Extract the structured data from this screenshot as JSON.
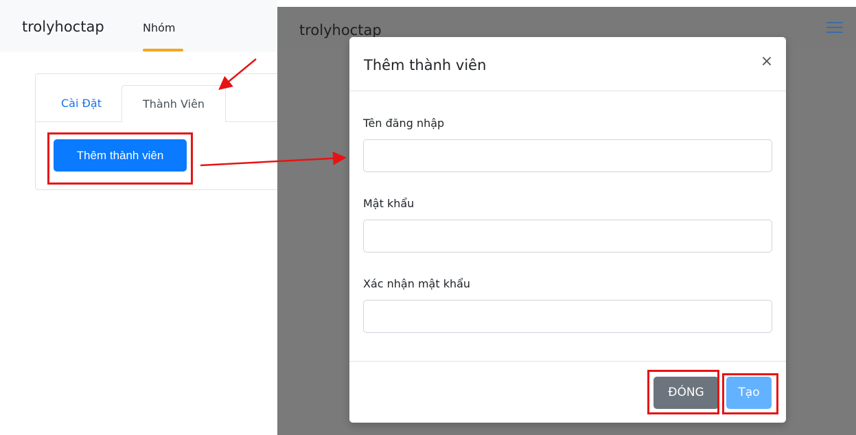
{
  "left_panel": {
    "brand": "trolyhoctap",
    "nav_link": "Nhóm",
    "tabs": [
      {
        "label": "Cài Đặt"
      },
      {
        "label": "Thành Viên"
      }
    ],
    "add_member_button": "Thêm thành viên"
  },
  "right_panel": {
    "brand": "trolyhoctap"
  },
  "modal": {
    "title": "Thêm thành viên",
    "close_symbol": "×",
    "fields": [
      {
        "label": "Tên đăng nhập",
        "value": ""
      },
      {
        "label": "Mật khẩu",
        "value": ""
      },
      {
        "label": "Xác nhận mật khẩu",
        "value": ""
      }
    ],
    "close_button": "ĐÓNG",
    "create_button": "Tạo"
  },
  "colors": {
    "primary": "#0a7aff",
    "secondary": "#6c757d",
    "create_light": "#62b2ff",
    "nav_accent": "#f5a623",
    "annotation": "#e51414",
    "overlay": "#7a7a7a"
  },
  "icons": {
    "menu": "hamburger-icon",
    "close": "close-icon"
  }
}
